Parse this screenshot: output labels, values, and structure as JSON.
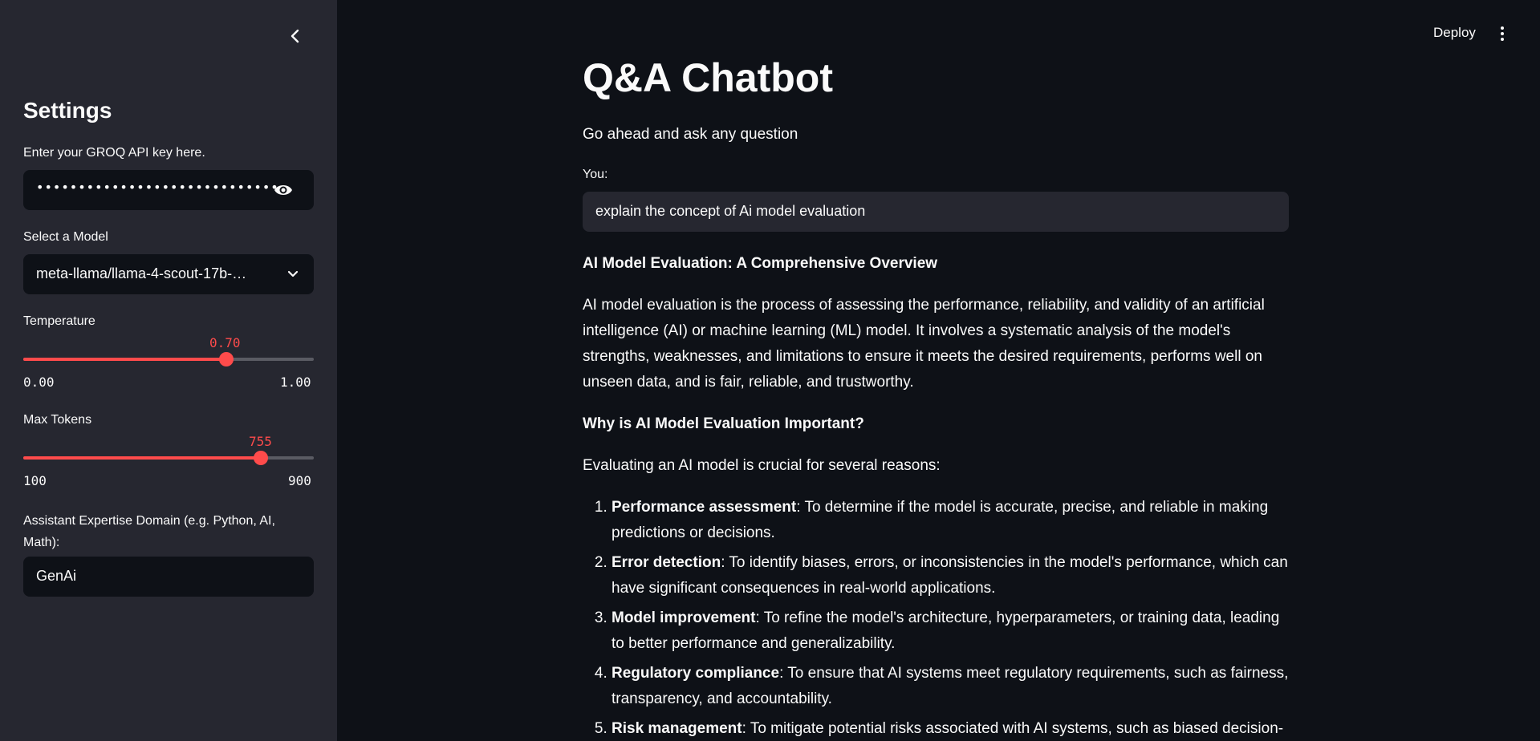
{
  "header": {
    "deploy_label": "Deploy"
  },
  "sidebar": {
    "title": "Settings",
    "api_key_label": "Enter your GROQ API key here.",
    "api_key_masked": "•••••••••••••••••••••••••••••••••••••••••••••••••••••",
    "model_label": "Select a Model",
    "model_value": "meta-llama/llama-4-scout-17b-…",
    "temperature": {
      "label": "Temperature",
      "value": "0.70",
      "min": "0.00",
      "max": "1.00",
      "fraction": 0.7
    },
    "max_tokens": {
      "label": "Max Tokens",
      "value": "755",
      "min": "100",
      "max": "900",
      "fraction": 0.81875
    },
    "domain_label": "Assistant Expertise Domain (e.g. Python, AI, Math):",
    "domain_value": "GenAi"
  },
  "main": {
    "title": "Q&A Chatbot",
    "subtitle": "Go ahead and ask any question",
    "you_label": "You:",
    "query_value": "explain the concept of Ai model evaluation",
    "response": {
      "heading": "AI Model Evaluation: A Comprehensive Overview",
      "intro": "AI model evaluation is the process of assessing the performance, reliability, and validity of an artificial intelligence (AI) or machine learning (ML) model. It involves a systematic analysis of the model's strengths, weaknesses, and limitations to ensure it meets the desired requirements, performs well on unseen data, and is fair, reliable, and trustworthy.",
      "why_heading": "Why is AI Model Evaluation Important?",
      "why_intro": "Evaluating an AI model is crucial for several reasons:",
      "reasons": [
        {
          "term": "Performance assessment",
          "text": ": To determine if the model is accurate, precise, and reliable in making predictions or decisions."
        },
        {
          "term": "Error detection",
          "text": ": To identify biases, errors, or inconsistencies in the model's performance, which can have significant consequences in real-world applications."
        },
        {
          "term": "Model improvement",
          "text": ": To refine the model's architecture, hyperparameters, or training data, leading to better performance and generalizability."
        },
        {
          "term": "Regulatory compliance",
          "text": ": To ensure that AI systems meet regulatory requirements, such as fairness, transparency, and accountability."
        },
        {
          "term": "Risk management",
          "text": ": To mitigate potential risks associated with AI systems, such as biased decision-"
        }
      ]
    }
  },
  "colors": {
    "accent": "#ff4b4b",
    "sidebar_bg": "#262730",
    "main_bg": "#0e1117"
  }
}
